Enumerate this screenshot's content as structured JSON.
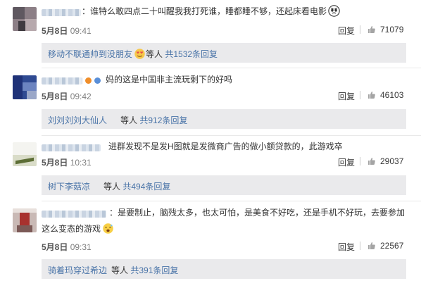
{
  "comments": [
    {
      "text": "：谁特么敢四点二十叫醒我我打死谁，睡都睡不够，还起床看电影",
      "date_day": "5月8日",
      "time": "09:41",
      "reply_label": "回复",
      "likes": "71079",
      "sub": {
        "user": "移动不联通帅到没朋友",
        "mid": "等人",
        "total": "共1532条回复"
      }
    },
    {
      "text": "妈的这是中国非主流玩剩下的好吗",
      "date_day": "5月8日",
      "time": "09:42",
      "reply_label": "回复",
      "likes": "46103",
      "sub": {
        "user": "刘刘刘刘大仙人",
        "mid": "等人",
        "total": "共912条回复"
      }
    },
    {
      "text": "进群发现不是发H图就是发微商广告的做小额贷款的，此游戏卒",
      "date_day": "5月8日",
      "time": "10:31",
      "reply_label": "回复",
      "likes": "29037",
      "sub": {
        "user": "树下李菇凉",
        "mid": "等人",
        "total": "共494条回复"
      }
    },
    {
      "text_line1": "：是要制止，脑残太多，也太可怕，是美食不好吃，还是手机不好玩，去要参加",
      "text_line2": "这么变态的游戏",
      "date_day": "5月8日",
      "time": "09:31",
      "reply_label": "回复",
      "likes": "22567",
      "sub": {
        "user": "骑着玛穿过希边",
        "mid": "等人",
        "total": "共391条回复"
      }
    }
  ],
  "icons": {
    "like": "thumbs-up-icon",
    "emoji1": "angry-face-icon",
    "emoji2": "love-face-icon",
    "emoji3": "yawn-face-icon"
  }
}
